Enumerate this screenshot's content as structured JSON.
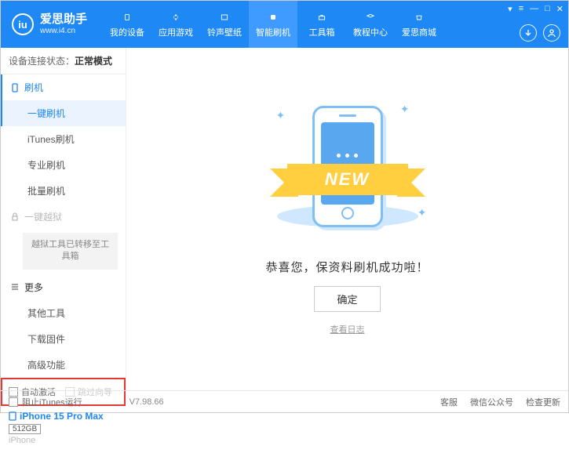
{
  "header": {
    "logo_letter": "iu",
    "title": "爱思助手",
    "subtitle": "www.i4.cn",
    "nav": [
      {
        "label": "我的设备"
      },
      {
        "label": "应用游戏"
      },
      {
        "label": "铃声壁纸"
      },
      {
        "label": "智能刷机",
        "active": true
      },
      {
        "label": "工具箱"
      },
      {
        "label": "教程中心"
      },
      {
        "label": "爱思商城"
      }
    ]
  },
  "sidebar": {
    "conn_label": "设备连接状态：",
    "conn_status": "正常模式",
    "groups": {
      "flash": {
        "title": "刷机",
        "items": [
          "一键刷机",
          "iTunes刷机",
          "专业刷机",
          "批量刷机"
        ],
        "active_index": 0
      },
      "jailbreak": {
        "title": "一键越狱",
        "note": "越狱工具已转移至工具箱"
      },
      "more": {
        "title": "更多",
        "items": [
          "其他工具",
          "下载固件",
          "高级功能"
        ]
      }
    },
    "checks": {
      "auto_activate": "自动激活",
      "skip_guide": "跳过向导"
    },
    "device": {
      "name": "iPhone 15 Pro Max",
      "capacity": "512GB",
      "type": "iPhone"
    }
  },
  "main": {
    "ribbon": "NEW",
    "message": "恭喜您，保资料刷机成功啦！",
    "ok": "确定",
    "view_log": "查看日志"
  },
  "footer": {
    "block_itunes": "阻止iTunes运行",
    "version": "V7.98.66",
    "links": [
      "客服",
      "微信公众号",
      "检查更新"
    ]
  }
}
